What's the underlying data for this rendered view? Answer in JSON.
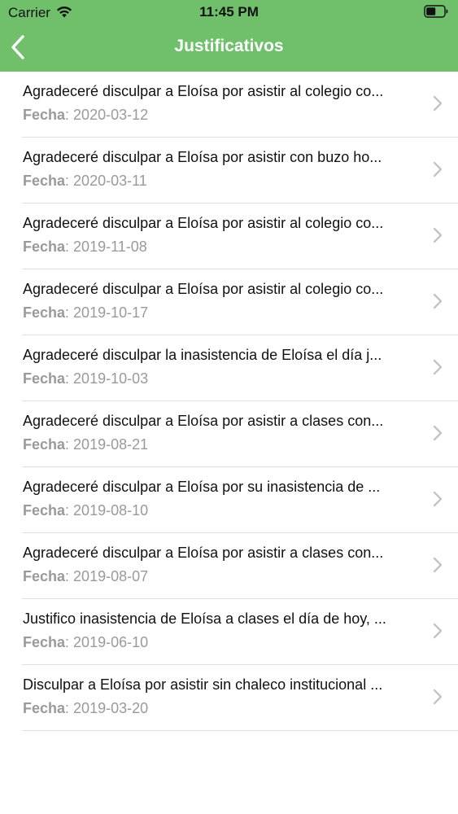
{
  "status_bar": {
    "carrier": "Carrier",
    "time": "11:45 PM",
    "wifi_icon": "wifi-icon",
    "battery_icon": "battery-icon"
  },
  "nav": {
    "title": "Justificativos",
    "back_icon": "chevron-left-icon"
  },
  "colors": {
    "header_green": "#6fbf6b",
    "secondary_text": "#9a9a9a",
    "separator": "#e2e2e2",
    "chevron": "#c4c4c4"
  },
  "list": {
    "date_label": "Fecha",
    "chevron_icon": "chevron-right-icon",
    "items": [
      {
        "title": "Agradeceré disculpar a Eloísa por asistir al colegio co...",
        "date": "2020-03-12"
      },
      {
        "title": "Agradeceré disculpar a Eloísa por asistir con buzo ho...",
        "date": "2020-03-11"
      },
      {
        "title": "Agradeceré disculpar a Eloísa por asistir al colegio co...",
        "date": "2019-11-08"
      },
      {
        "title": "Agradeceré disculpar a Eloísa por asistir al colegio co...",
        "date": "2019-10-17"
      },
      {
        "title": "Agradeceré disculpar la inasistencia de Eloísa el día j...",
        "date": "2019-10-03"
      },
      {
        "title": "Agradeceré disculpar a Eloísa por asistir a clases con...",
        "date": "2019-08-21"
      },
      {
        "title": "Agradeceré disculpar a Eloísa por su inasistencia de ...",
        "date": "2019-08-10"
      },
      {
        "title": "Agradeceré disculpar a Eloísa por asistir a clases con...",
        "date": "2019-08-07"
      },
      {
        "title": "Justifico inasistencia de Eloísa a clases el día de hoy, ...",
        "date": "2019-06-10"
      },
      {
        "title": "Disculpar a Eloísa por asistir sin chaleco institucional ...",
        "date": "2019-03-20"
      }
    ]
  }
}
